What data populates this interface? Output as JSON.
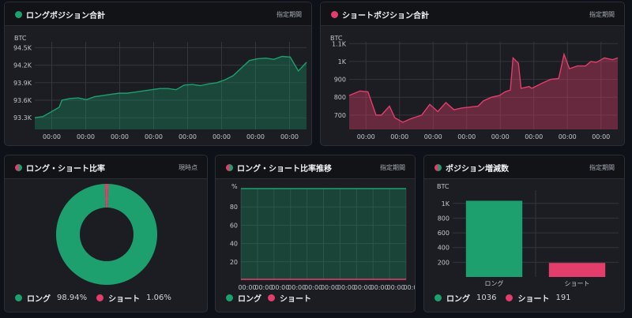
{
  "colors": {
    "long": "#1da06e",
    "short": "#e23d6b",
    "grid": "#33363d",
    "axis_text": "#c2c6cc"
  },
  "panels": {
    "long_total": {
      "title": "ロングポジション合計",
      "range_label": "指定期間"
    },
    "short_total": {
      "title": "ショートポジション合計",
      "range_label": "指定期間"
    },
    "ratio": {
      "title": "ロング・ショート比率",
      "range_label": "現時点"
    },
    "ratio_trend": {
      "title": "ロング・ショート比率推移",
      "range_label": "指定期間"
    },
    "position_change": {
      "title": "ポジション増減数",
      "range_label": "指定期間"
    }
  },
  "legends": {
    "ratio": {
      "long_label": "ロング",
      "long_value": "98.94%",
      "short_label": "ショート",
      "short_value": "1.06%"
    },
    "trend": {
      "long_label": "ロング",
      "short_label": "ショート"
    },
    "change": {
      "long_label": "ロング",
      "long_value": "1036",
      "short_label": "ショート",
      "short_value": "191"
    }
  },
  "chart_data": [
    {
      "type": "area",
      "unit": "BTC",
      "ylim": [
        93100,
        94600
      ],
      "yticks": [
        93300,
        93600,
        93900,
        94200,
        94500
      ],
      "ytick_labels": [
        "93.3K",
        "93.6K",
        "93.9K",
        "94.2K",
        "94.5K"
      ],
      "xtick_labels": [
        "00:00",
        "00:00",
        "00:00",
        "00:00",
        "00:00",
        "00:00",
        "00:00",
        "00:00"
      ],
      "x": [
        0,
        3,
        6,
        9,
        10,
        13,
        16,
        19,
        22,
        25,
        28,
        31,
        34,
        37,
        40,
        43,
        46,
        49,
        52,
        55,
        58,
        61,
        64,
        67,
        70,
        73,
        76,
        79,
        82,
        85,
        88,
        91,
        94,
        97,
        100
      ],
      "values": [
        93300,
        93320,
        93400,
        93480,
        93600,
        93630,
        93640,
        93610,
        93660,
        93680,
        93700,
        93720,
        93720,
        93740,
        93760,
        93780,
        93800,
        93800,
        93780,
        93860,
        93870,
        93850,
        93880,
        93900,
        93950,
        94020,
        94150,
        94280,
        94310,
        94320,
        94300,
        94350,
        94340,
        94100,
        94250
      ],
      "grid": true
    },
    {
      "type": "area",
      "unit": "BTC",
      "ylim": [
        620,
        1110
      ],
      "yticks": [
        700,
        800,
        900,
        1000,
        1100
      ],
      "ytick_labels": [
        "700",
        "800",
        "900",
        "1K",
        "1.1K"
      ],
      "xtick_labels": [
        "00:00",
        "00:00",
        "00:00",
        "00:00",
        "00:00",
        "00:00",
        "00:00",
        "00:00"
      ],
      "x": [
        0,
        4,
        7,
        10,
        12,
        15,
        17,
        20,
        23,
        25,
        27,
        30,
        33,
        36,
        39,
        42,
        45,
        48,
        50,
        53,
        56,
        58,
        60,
        61,
        63,
        64,
        67,
        68,
        72,
        75,
        78,
        80,
        82,
        85,
        88,
        90,
        92,
        95,
        98,
        100
      ],
      "values": [
        810,
        835,
        830,
        700,
        700,
        750,
        685,
        660,
        680,
        690,
        700,
        760,
        720,
        770,
        730,
        740,
        745,
        750,
        780,
        800,
        810,
        830,
        840,
        1020,
        990,
        850,
        860,
        850,
        880,
        900,
        905,
        1040,
        960,
        975,
        975,
        1000,
        995,
        1020,
        1010,
        1020
      ],
      "grid": true
    },
    {
      "type": "pie",
      "donut": true,
      "categories": [
        "ロング",
        "ショート"
      ],
      "values": [
        98.94,
        1.06
      ]
    },
    {
      "type": "area",
      "unit": "%",
      "ylim": [
        0,
        100
      ],
      "yticks": [
        20,
        40,
        60,
        80
      ],
      "ytick_labels": [
        "20",
        "40",
        "60",
        "80"
      ],
      "xtick_labels": [
        "00:00",
        "00:00",
        "00:00",
        "00:00",
        "00:00",
        "00:00",
        "00:00",
        "00:00",
        "00:00",
        "00:00",
        "00:00"
      ],
      "series": [
        {
          "name": "ロング",
          "values": [
            99,
            99,
            99,
            99,
            99,
            99,
            99,
            99,
            99,
            99,
            99
          ]
        },
        {
          "name": "ショート",
          "values": [
            1,
            1,
            1,
            1,
            1,
            1,
            1,
            1,
            1,
            1,
            1
          ]
        }
      ],
      "grid": true
    },
    {
      "type": "bar",
      "unit": "BTC",
      "ylim": [
        0,
        1180
      ],
      "yticks": [
        200,
        400,
        600,
        800,
        1000
      ],
      "ytick_labels": [
        "200",
        "400",
        "600",
        "800",
        "1K"
      ],
      "categories": [
        "ロング",
        "ショート"
      ],
      "values": [
        1036,
        191
      ],
      "grid": true
    }
  ]
}
